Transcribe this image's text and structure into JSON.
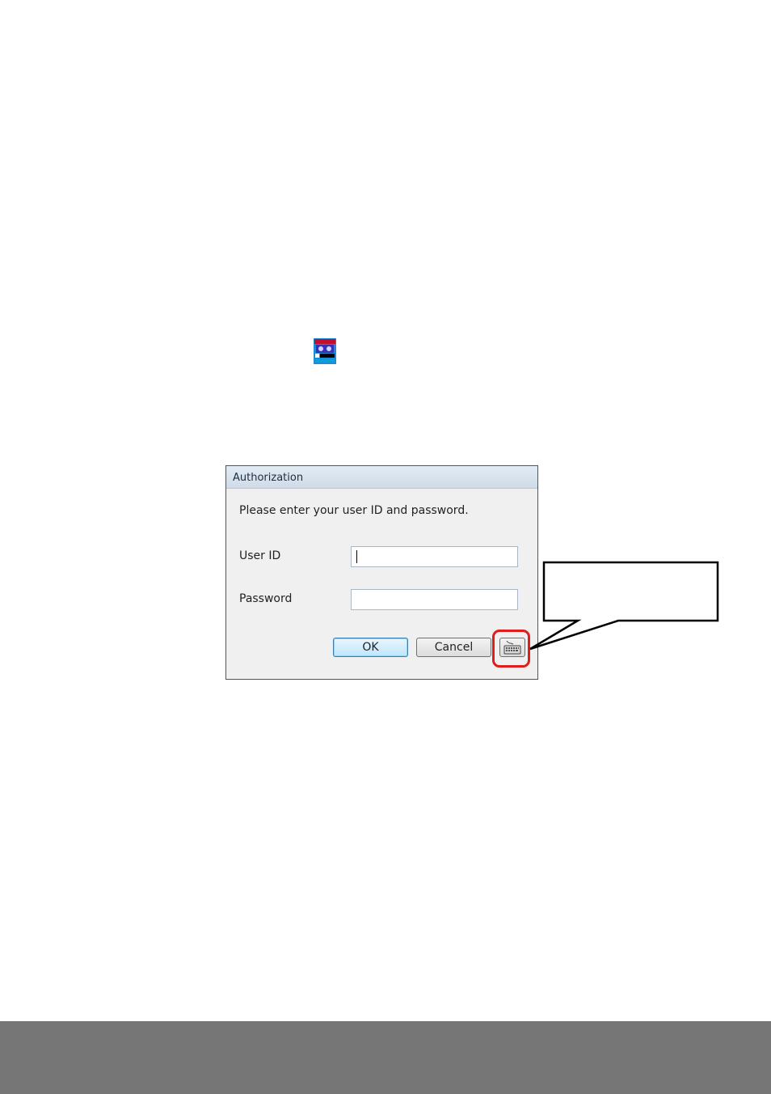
{
  "dialog": {
    "title": "Authorization",
    "prompt": "Please enter your user ID and password.",
    "user_id_label": "User ID",
    "user_id_value": "",
    "password_label": "Password",
    "password_value": "",
    "ok_label": "OK",
    "cancel_label": "Cancel"
  },
  "icons": {
    "app": "app-shortcut-icon",
    "keyboard": "keyboard-icon"
  },
  "colors": {
    "highlight": "#e01c1c",
    "footer": "#767676"
  }
}
